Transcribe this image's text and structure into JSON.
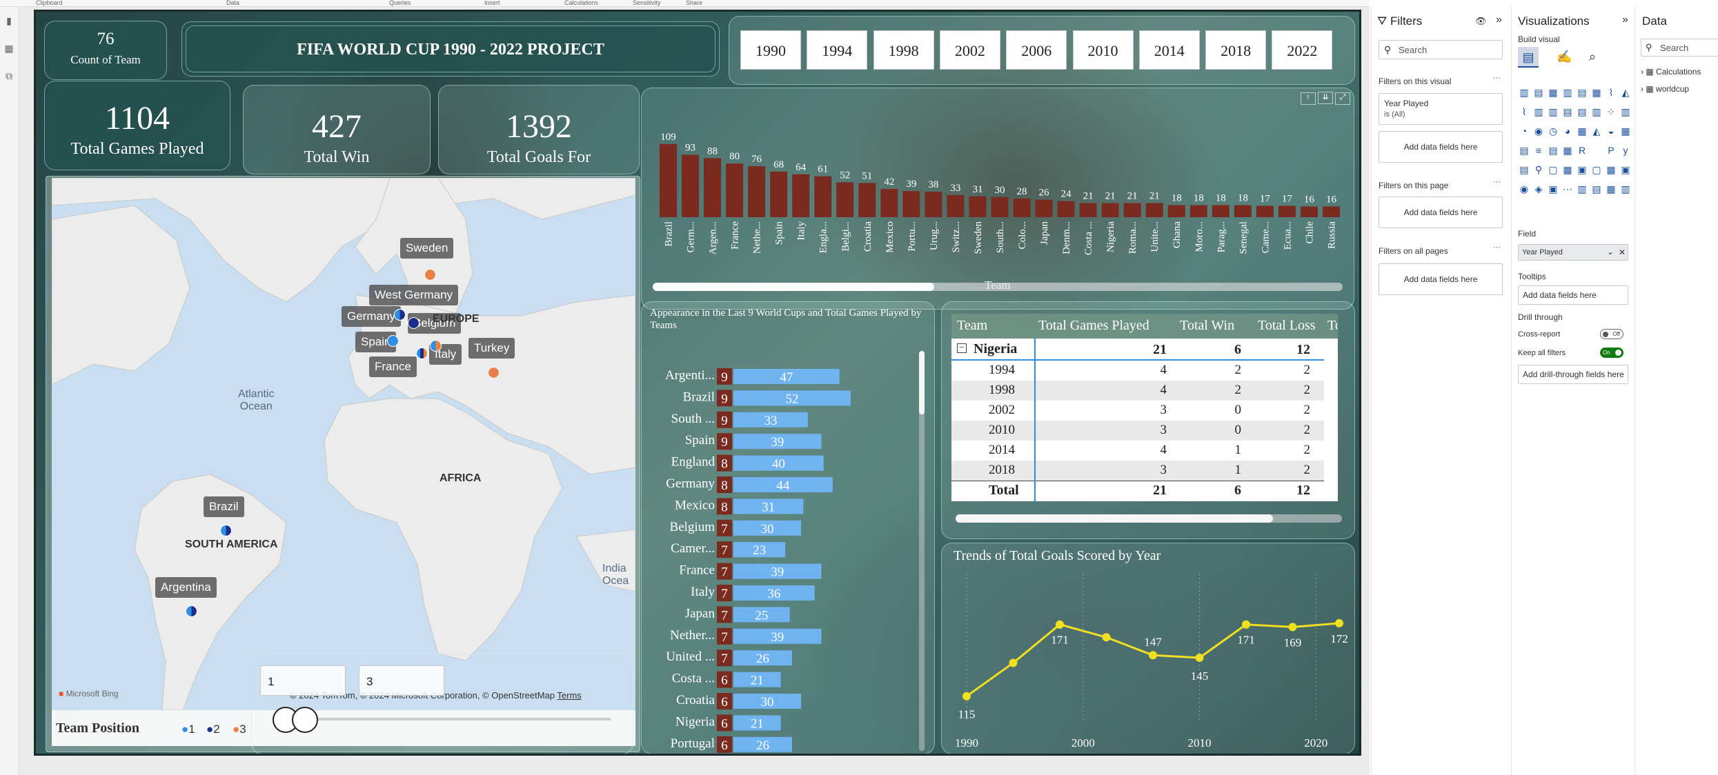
{
  "ribbon": [
    "Clipboard",
    "Data",
    "Queries",
    "Insert",
    "Calculations",
    "Sensitivity",
    "Share"
  ],
  "header": {
    "team_count": "76",
    "team_count_label": "Count of Team",
    "title": "FIFA WORLD CUP 1990 - 2022 PROJECT"
  },
  "years": [
    "1990",
    "1994",
    "1998",
    "2002",
    "2006",
    "2010",
    "2014",
    "2018",
    "2022"
  ],
  "kpis": [
    {
      "value": "1104",
      "label": "Total Games Played"
    },
    {
      "value": "427",
      "label": "Total Win"
    },
    {
      "value": "1392",
      "label": "Total Goals For"
    }
  ],
  "map": {
    "labels": {
      "sweden": "Sweden",
      "west_germany": "West Germany",
      "germany": "Germany",
      "belgium": "Belgium",
      "spain": "Spain",
      "france": "France",
      "italy": "Italy",
      "turkey": "Turkey",
      "brazil": "Brazil",
      "argentina": "Argentina"
    },
    "regions": {
      "europe": "EUROPE",
      "atlantic": "Atlantic\nOcean",
      "africa": "AFRICA",
      "south_america": "SOUTH AMERICA",
      "indian": "India\nOcea"
    },
    "bing": "Microsoft Bing",
    "copyright": "© 2024 TomTom, © 2024 Microsoft Corporation, © OpenStreetMap",
    "terms": "Terms",
    "legend_title": "Team Position",
    "legend": [
      {
        "label": "1",
        "color": "#2f8de4"
      },
      {
        "label": "2",
        "color": "#1a2e8a"
      },
      {
        "label": "3",
        "color": "#e8804a"
      }
    ],
    "slider_from": "1",
    "slider_to": "3"
  },
  "chart_data": [
    {
      "type": "bar",
      "xlabel": "Team",
      "categories": [
        "Brazil",
        "Germ...",
        "Argen...",
        "France",
        "Nethe...",
        "Spain",
        "Italy",
        "Engla...",
        "Belgi...",
        "Croatia",
        "Mexico",
        "Portu...",
        "Urug...",
        "Switz...",
        "Sweden",
        "South...",
        "Colo...",
        "Japan",
        "Denm...",
        "Costa ...",
        "Nigeria",
        "Roma...",
        "Unite...",
        "Ghana",
        "Moro...",
        "Parag...",
        "Senegal",
        "Came...",
        "Ecua...",
        "Chile",
        "Russia"
      ],
      "values": [
        109,
        93,
        88,
        80,
        76,
        68,
        64,
        61,
        52,
        51,
        42,
        39,
        38,
        33,
        31,
        30,
        28,
        26,
        24,
        21,
        21,
        21,
        21,
        18,
        18,
        18,
        18,
        17,
        17,
        16,
        16
      ],
      "color": "#7a2a1e"
    },
    {
      "type": "bar",
      "title": "Appearance in the Last 9 World Cups and Total Games Played by Teams",
      "categories": [
        "Argenti...",
        "Brazil",
        "South ...",
        "Spain",
        "England",
        "Germany",
        "Mexico",
        "Belgium",
        "Camer...",
        "France",
        "Italy",
        "Japan",
        "Nether...",
        "United ...",
        "Costa ...",
        "Croatia",
        "Nigeria",
        "Portugal"
      ],
      "series": [
        {
          "values": [
            9,
            9,
            9,
            9,
            8,
            8,
            8,
            7,
            7,
            7,
            7,
            7,
            7,
            7,
            6,
            6,
            6,
            6
          ],
          "color": "#7a2a1e"
        },
        {
          "values": [
            47,
            52,
            33,
            39,
            40,
            44,
            31,
            30,
            23,
            39,
            36,
            25,
            39,
            26,
            21,
            30,
            21,
            26
          ],
          "color": "#6fb3f0"
        }
      ]
    },
    {
      "type": "line",
      "title": "Trends of Total Goals Scored by Year",
      "x": [
        1990,
        1994,
        1998,
        2002,
        2006,
        2010,
        2014,
        2018,
        2022
      ],
      "y": [
        115,
        141,
        171,
        161,
        147,
        145,
        171,
        169,
        172
      ],
      "labels": [
        "115",
        "",
        "171",
        "",
        "147",
        "145",
        "171",
        "169",
        "172"
      ],
      "xticks": [
        "1990",
        "2000",
        "2010",
        "2020"
      ],
      "color": "#f0e020"
    }
  ],
  "table": {
    "headers": [
      "Team",
      "Total Games Played",
      "Total Win",
      "Total Loss",
      "To"
    ],
    "group": {
      "label": "Nigeria",
      "games": "21",
      "win": "6",
      "loss": "12"
    },
    "rows": [
      {
        "year": "1994",
        "games": "4",
        "win": "2",
        "loss": "2"
      },
      {
        "year": "1998",
        "games": "4",
        "win": "2",
        "loss": "2"
      },
      {
        "year": "2002",
        "games": "3",
        "win": "0",
        "loss": "2"
      },
      {
        "year": "2010",
        "games": "3",
        "win": "0",
        "loss": "2"
      },
      {
        "year": "2014",
        "games": "4",
        "win": "1",
        "loss": "2"
      },
      {
        "year": "2018",
        "games": "3",
        "win": "1",
        "loss": "2"
      }
    ],
    "total": {
      "label": "Total",
      "games": "21",
      "win": "6",
      "loss": "12"
    }
  },
  "filters": {
    "title": "Filters",
    "search": "Search",
    "on_visual": "Filters on this visual",
    "chip_line1": "Year Played",
    "chip_line2": "is (All)",
    "add": "Add data fields here",
    "on_page": "Filters on this page",
    "on_all": "Filters on all pages"
  },
  "viz": {
    "title": "Visualizations",
    "build": "Build visual",
    "field": "Field",
    "field_value": "Year Played",
    "tooltips": "Tooltips",
    "tooltips_add": "Add data fields here",
    "drill": "Drill through",
    "cross": "Cross-report",
    "cross_state": "Off",
    "keep": "Keep all filters",
    "keep_state": "On",
    "drill_add": "Add drill-through fields here"
  },
  "data_pane": {
    "title": "Data",
    "search": "Search",
    "items": [
      "Calculations",
      "worldcup"
    ]
  }
}
